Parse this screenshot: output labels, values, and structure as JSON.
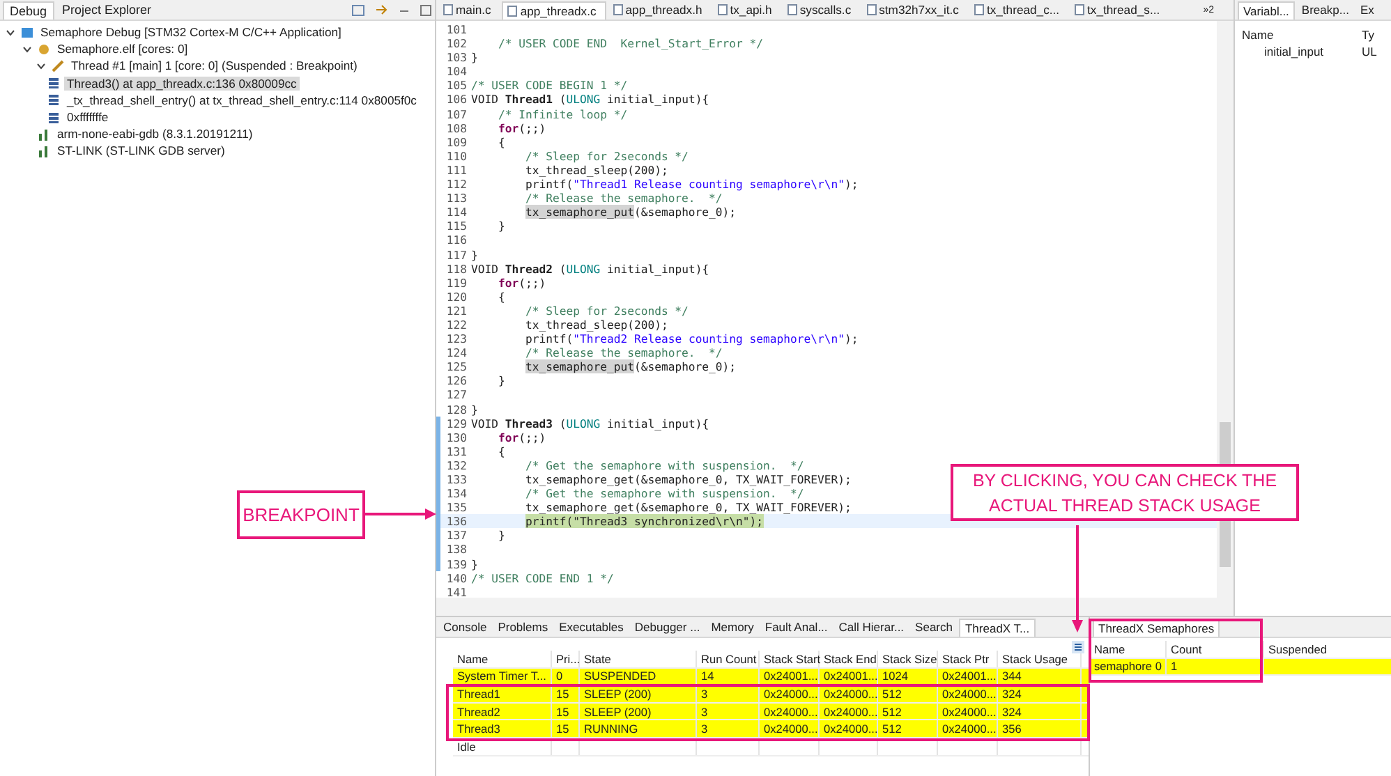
{
  "debug_panel": {
    "tabs": [
      {
        "label": "Debug",
        "selected": true
      },
      {
        "label": "Project Explorer",
        "selected": false
      }
    ],
    "tree": [
      {
        "label": "Semaphore Debug [STM32 Cortex-M C/C++ Application]",
        "kind": "launch",
        "selected": false,
        "expanded": true,
        "children": [
          {
            "label": "Semaphore.elf [cores: 0]",
            "kind": "elf",
            "selected": false,
            "expanded": true,
            "children": [
              {
                "label": "Thread #1 [main] 1 [core: 0] (Suspended : Breakpoint)",
                "kind": "thread",
                "selected": false,
                "expanded": true,
                "children": [
                  {
                    "label": "Thread3() at app_threadx.c:136 0x80009cc",
                    "kind": "frame",
                    "selected": true
                  },
                  {
                    "label": "_tx_thread_shell_entry() at tx_thread_shell_entry.c:114 0x8005f0c",
                    "kind": "frame",
                    "selected": false
                  },
                  {
                    "label": "0xfffffffe",
                    "kind": "frame",
                    "selected": false
                  }
                ]
              }
            ]
          },
          {
            "label": "arm-none-eabi-gdb (8.3.1.20191211)",
            "kind": "process",
            "selected": false
          },
          {
            "label": "ST-LINK (ST-LINK GDB server)",
            "kind": "process",
            "selected": false
          }
        ]
      }
    ]
  },
  "editor": {
    "tabs": [
      {
        "label": "main.c",
        "selected": false
      },
      {
        "label": "app_threadx.c",
        "selected": true
      },
      {
        "label": "app_threadx.h",
        "selected": false
      },
      {
        "label": "tx_api.h",
        "selected": false
      },
      {
        "label": "syscalls.c",
        "selected": false
      },
      {
        "label": "stm32h7xx_it.c",
        "selected": false
      },
      {
        "label": "tx_thread_c...",
        "selected": false
      },
      {
        "label": "tx_thread_s...",
        "selected": false
      }
    ],
    "overflow": "»2",
    "lines": [
      {
        "n": "101",
        "changed": false,
        "current": false
      },
      {
        "n": "102",
        "changed": false,
        "current": false,
        "seg": [
          {
            "kind": "comment",
            "text": "    /* USER CODE END  Kernel_Start_Error */"
          }
        ]
      },
      {
        "n": "103",
        "changed": false,
        "current": false,
        "seg": [
          {
            "kind": "plain",
            "text": "}"
          }
        ]
      },
      {
        "n": "104",
        "changed": false,
        "current": false
      },
      {
        "n": "105",
        "changed": false,
        "current": false,
        "seg": [
          {
            "kind": "comment",
            "text": "/* USER CODE BEGIN 1 */"
          }
        ]
      },
      {
        "n": "106",
        "changed": false,
        "current": false,
        "seg": [
          {
            "kind": "plain",
            "text": "VOID "
          },
          {
            "kind": "bold",
            "text": "Thread1"
          },
          {
            "kind": "plain",
            "text": " ("
          },
          {
            "kind": "type",
            "text": "ULONG"
          },
          {
            "kind": "plain",
            "text": " initial_input){"
          }
        ]
      },
      {
        "n": "107",
        "changed": false,
        "current": false,
        "seg": [
          {
            "kind": "comment",
            "text": "    /* Infinite loop */"
          }
        ]
      },
      {
        "n": "108",
        "changed": false,
        "current": false,
        "seg": [
          {
            "kind": "keyword",
            "text": "    for"
          },
          {
            "kind": "plain",
            "text": "(;;)"
          }
        ]
      },
      {
        "n": "109",
        "changed": false,
        "current": false,
        "seg": [
          {
            "kind": "plain",
            "text": "    {"
          }
        ]
      },
      {
        "n": "110",
        "changed": false,
        "current": false,
        "seg": [
          {
            "kind": "comment",
            "text": "        /* Sleep for 2seconds */"
          }
        ]
      },
      {
        "n": "111",
        "changed": false,
        "current": false,
        "seg": [
          {
            "kind": "plain",
            "text": "        tx_thread_sleep(200);"
          }
        ]
      },
      {
        "n": "112",
        "changed": false,
        "current": false,
        "seg": [
          {
            "kind": "plain",
            "text": "        printf("
          },
          {
            "kind": "string",
            "text": "\"Thread1 Release counting semaphore\\r\\n\""
          },
          {
            "kind": "plain",
            "text": ");"
          }
        ]
      },
      {
        "n": "113",
        "changed": false,
        "current": false,
        "seg": [
          {
            "kind": "comment",
            "text": "        /* Release the semaphore.  */"
          }
        ]
      },
      {
        "n": "114",
        "changed": false,
        "current": false,
        "seg": [
          {
            "kind": "occurrence",
            "text": "        tx_semaphore_put"
          },
          {
            "kind": "plain",
            "text": "(&semaphore_0);"
          }
        ]
      },
      {
        "n": "115",
        "changed": false,
        "current": false,
        "seg": [
          {
            "kind": "plain",
            "text": "    }"
          }
        ]
      },
      {
        "n": "116",
        "changed": false,
        "current": false
      },
      {
        "n": "117",
        "changed": false,
        "current": false,
        "seg": [
          {
            "kind": "plain",
            "text": "}"
          }
        ]
      },
      {
        "n": "118",
        "changed": false,
        "current": false,
        "seg": [
          {
            "kind": "plain",
            "text": "VOID "
          },
          {
            "kind": "bold",
            "text": "Thread2"
          },
          {
            "kind": "plain",
            "text": " ("
          },
          {
            "kind": "type",
            "text": "ULONG"
          },
          {
            "kind": "plain",
            "text": " initial_input){"
          }
        ]
      },
      {
        "n": "119",
        "changed": false,
        "current": false,
        "seg": [
          {
            "kind": "keyword",
            "text": "    for"
          },
          {
            "kind": "plain",
            "text": "(;;)"
          }
        ]
      },
      {
        "n": "120",
        "changed": false,
        "current": false,
        "seg": [
          {
            "kind": "plain",
            "text": "    {"
          }
        ]
      },
      {
        "n": "121",
        "changed": false,
        "current": false,
        "seg": [
          {
            "kind": "comment",
            "text": "        /* Sleep for 2seconds */"
          }
        ]
      },
      {
        "n": "122",
        "changed": false,
        "current": false,
        "seg": [
          {
            "kind": "plain",
            "text": "        tx_thread_sleep(200);"
          }
        ]
      },
      {
        "n": "123",
        "changed": false,
        "current": false,
        "seg": [
          {
            "kind": "plain",
            "text": "        printf("
          },
          {
            "kind": "string",
            "text": "\"Thread2 Release counting semaphore\\r\\n\""
          },
          {
            "kind": "plain",
            "text": ");"
          }
        ]
      },
      {
        "n": "124",
        "changed": false,
        "current": false,
        "seg": [
          {
            "kind": "comment",
            "text": "        /* Release the semaphore.  */"
          }
        ]
      },
      {
        "n": "125",
        "changed": false,
        "current": false,
        "seg": [
          {
            "kind": "occurrence",
            "text": "        tx_semaphore_put"
          },
          {
            "kind": "plain",
            "text": "(&semaphore_0);"
          }
        ]
      },
      {
        "n": "126",
        "changed": false,
        "current": false,
        "seg": [
          {
            "kind": "plain",
            "text": "    }"
          }
        ]
      },
      {
        "n": "127",
        "changed": false,
        "current": false
      },
      {
        "n": "128",
        "changed": false,
        "current": false,
        "seg": [
          {
            "kind": "plain",
            "text": "}"
          }
        ]
      },
      {
        "n": "129",
        "changed": true,
        "current": false,
        "seg": [
          {
            "kind": "plain",
            "text": "VOID "
          },
          {
            "kind": "bold",
            "text": "Thread3"
          },
          {
            "kind": "plain",
            "text": " ("
          },
          {
            "kind": "type",
            "text": "ULONG"
          },
          {
            "kind": "plain",
            "text": " initial_input){"
          }
        ]
      },
      {
        "n": "130",
        "changed": true,
        "current": false,
        "seg": [
          {
            "kind": "keyword",
            "text": "    for"
          },
          {
            "kind": "plain",
            "text": "(;;)"
          }
        ]
      },
      {
        "n": "131",
        "changed": true,
        "current": false,
        "seg": [
          {
            "kind": "plain",
            "text": "    {"
          }
        ]
      },
      {
        "n": "132",
        "changed": true,
        "current": false,
        "seg": [
          {
            "kind": "comment",
            "text": "        /* Get the semaphore with suspension.  */"
          }
        ]
      },
      {
        "n": "133",
        "changed": true,
        "current": false,
        "seg": [
          {
            "kind": "plain",
            "text": "        tx_semaphore_get(&semaphore_0, TX_WAIT_FOREVER);"
          }
        ]
      },
      {
        "n": "134",
        "changed": true,
        "current": false,
        "seg": [
          {
            "kind": "comment",
            "text": "        /* Get the semaphore with suspension.  */"
          }
        ]
      },
      {
        "n": "135",
        "changed": true,
        "current": false,
        "seg": [
          {
            "kind": "plain",
            "text": "        tx_semaphore_get(&semaphore_0, TX_WAIT_FOREVER);"
          }
        ]
      },
      {
        "n": "136",
        "changed": true,
        "current": true,
        "seg": [
          {
            "kind": "exec",
            "text": "        printf(\"Thread3 synchronized\\r\\n\");"
          }
        ]
      },
      {
        "n": "137",
        "changed": true,
        "current": false,
        "seg": [
          {
            "kind": "plain",
            "text": "    }"
          }
        ]
      },
      {
        "n": "138",
        "changed": true,
        "current": false
      },
      {
        "n": "139",
        "changed": true,
        "current": false,
        "seg": [
          {
            "kind": "plain",
            "text": "}"
          }
        ]
      },
      {
        "n": "140",
        "changed": false,
        "current": false,
        "seg": [
          {
            "kind": "comment",
            "text": "/* USER CODE END 1 */"
          }
        ]
      },
      {
        "n": "141",
        "changed": false,
        "current": false
      }
    ]
  },
  "variables_panel": {
    "tabs": [
      {
        "label": "Variabl...",
        "selected": true
      },
      {
        "label": "Breakp...",
        "selected": false
      },
      {
        "label": "Ex",
        "selected": false
      }
    ],
    "columns": [
      "Name",
      "Ty"
    ],
    "rows": [
      [
        "initial_input",
        "UL"
      ]
    ]
  },
  "threads_panel": {
    "tabs": [
      {
        "label": "Console",
        "selected": false
      },
      {
        "label": "Problems",
        "selected": false
      },
      {
        "label": "Executables",
        "selected": false
      },
      {
        "label": "Debugger ...",
        "selected": false
      },
      {
        "label": "Memory",
        "selected": false
      },
      {
        "label": "Fault Anal...",
        "selected": false
      },
      {
        "label": "Call Hierar...",
        "selected": false
      },
      {
        "label": "Search",
        "selected": false
      },
      {
        "label": "ThreadX T...",
        "selected": true
      }
    ],
    "columns": [
      "Name",
      "Pri...",
      "State",
      "Run Count",
      "Stack Start",
      "Stack End",
      "Stack Size",
      "Stack Ptr",
      "Stack Usage"
    ],
    "rows": [
      {
        "highlighted": true,
        "cells": [
          "System Timer T...",
          "0",
          "SUSPENDED",
          "14",
          "0x24001...",
          "0x24001...",
          "1024",
          "0x24001...",
          "344"
        ]
      },
      {
        "highlighted": true,
        "cells": [
          "Thread1",
          "15",
          "SLEEP (200)",
          "3",
          "0x24000...",
          "0x24000...",
          "512",
          "0x24000...",
          "324"
        ]
      },
      {
        "highlighted": true,
        "cells": [
          "Thread2",
          "15",
          "SLEEP (200)",
          "3",
          "0x24000...",
          "0x24000...",
          "512",
          "0x24000...",
          "324"
        ]
      },
      {
        "highlighted": true,
        "cells": [
          "Thread3",
          "15",
          "RUNNING",
          "3",
          "0x24000...",
          "0x24000...",
          "512",
          "0x24000...",
          "356"
        ]
      },
      {
        "highlighted": false,
        "cells": [
          "Idle"
        ]
      }
    ]
  },
  "semaphores_panel": {
    "tab": "ThreadX Semaphores",
    "columns": [
      "Name",
      "Count",
      "Suspended"
    ],
    "rows": [
      {
        "highlighted": true,
        "cells": [
          "semaphore 0",
          "1"
        ]
      }
    ]
  },
  "annotations": [
    {
      "kind": "breakpoint",
      "text": "BREAKPOINT"
    },
    {
      "kind": "callout",
      "text": "BY CLICKING, YOU CAN CHECK THE ACTUAL THREAD STACK USAGE"
    }
  ]
}
